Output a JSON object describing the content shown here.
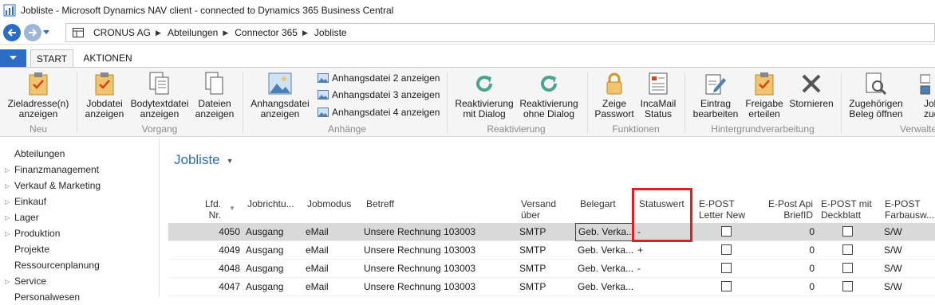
{
  "window": {
    "title": "Jobliste - Microsoft Dynamics NAV client - connected to Dynamics 365 Business Central"
  },
  "nav": {
    "breadcrumbs": [
      "CRONUS AG",
      "Abteilungen",
      "Connector 365",
      "Jobliste"
    ]
  },
  "tabs": {
    "start": "START",
    "aktionen": "AKTIONEN"
  },
  "ribbon": {
    "neu": {
      "label": "Neu",
      "zieladresse": [
        "Zieladresse(n)",
        "anzeigen"
      ]
    },
    "vorgang": {
      "label": "Vorgang",
      "jobdatei": [
        "Jobdatei",
        "anzeigen"
      ],
      "bodytext": [
        "Bodytextdatei",
        "anzeigen"
      ],
      "dateien": [
        "Dateien",
        "anzeigen"
      ]
    },
    "anhaenge": {
      "label": "Anhänge",
      "anhang1": [
        "Anhangsdatei",
        "anzeigen"
      ],
      "anhang2": "Anhangsdatei 2 anzeigen",
      "anhang3": "Anhangsdatei 3 anzeigen",
      "anhang4": "Anhangsdatei 4 anzeigen"
    },
    "reaktivierung": {
      "label": "Reaktivierung",
      "mitdialog": [
        "Reaktivierung",
        "mit Dialog"
      ],
      "ohnedialog": [
        "Reaktivierung",
        "ohne Dialog"
      ]
    },
    "funktionen": {
      "label": "Funktionen",
      "passwort": [
        "Zeige",
        "Passwort"
      ],
      "incamail": [
        "IncaMail",
        "Status"
      ]
    },
    "hintergrund": {
      "label": "Hintergrundverarbeitung",
      "eintrag": [
        "Eintrag",
        "bearbeiten"
      ],
      "freigabe": [
        "Freigabe",
        "erteilen"
      ],
      "stornieren": "Stornieren"
    },
    "verwalten": {
      "label": "Verwalte",
      "zugehoerig": [
        "Zugehörigen",
        "Beleg öffnen"
      ],
      "job": [
        "Job",
        "zuord"
      ]
    }
  },
  "sidebar": {
    "items": [
      {
        "label": "Abteilungen",
        "arrow": ""
      },
      {
        "label": "Finanzmanagement",
        "arrow": "▷"
      },
      {
        "label": "Verkauf & Marketing",
        "arrow": "▷"
      },
      {
        "label": "Einkauf",
        "arrow": "▷"
      },
      {
        "label": "Lager",
        "arrow": "▷"
      },
      {
        "label": "Produktion",
        "arrow": "▷"
      },
      {
        "label": "Projekte",
        "arrow": ""
      },
      {
        "label": "Ressourcenplanung",
        "arrow": ""
      },
      {
        "label": "Service",
        "arrow": "▷"
      },
      {
        "label": "Personalwesen",
        "arrow": ""
      }
    ]
  },
  "page": {
    "title": "Jobliste"
  },
  "table": {
    "headers": {
      "lfd": [
        "Lfd.",
        "Nr."
      ],
      "jobrichtung": "Jobrichtu...",
      "jobmodus": "Jobmodus",
      "betreff": "Betreff",
      "versand": [
        "Versand",
        "über"
      ],
      "belegart": "Belegart",
      "statuswert": "Statuswert",
      "epost_letter": [
        "E-POST",
        "Letter New"
      ],
      "epost_api": [
        "E-Post Api",
        "BriefID"
      ],
      "epost_deckblatt": [
        "E-POST mit",
        "Deckblatt"
      ],
      "epost_farb": [
        "E-POST",
        "Farbausw..."
      ]
    },
    "rows": [
      {
        "nr": "4050",
        "richtung": "Ausgang",
        "modus": "eMail",
        "betreff": "Unsere Rechnung 103003",
        "versand": "SMTP",
        "belegart": "Geb. Verka...",
        "status": "-",
        "letter_new": false,
        "briefid": "0",
        "deckblatt": false,
        "farb": "S/W"
      },
      {
        "nr": "4049",
        "richtung": "Ausgang",
        "modus": "eMail",
        "betreff": "Unsere Rechnung 103003",
        "versand": "SMTP",
        "belegart": "Geb. Verka...",
        "status": "+",
        "letter_new": false,
        "briefid": "0",
        "deckblatt": false,
        "farb": "S/W"
      },
      {
        "nr": "4048",
        "richtung": "Ausgang",
        "modus": "eMail",
        "betreff": "Unsere Rechnung 103003",
        "versand": "SMTP",
        "belegart": "Geb. Verka...",
        "status": "-",
        "letter_new": false,
        "briefid": "0",
        "deckblatt": false,
        "farb": "S/W"
      },
      {
        "nr": "4047",
        "richtung": "Ausgang",
        "modus": "eMail",
        "betreff": "Unsere Rechnung 103003",
        "versand": "SMTP",
        "belegart": "Geb. Verka...",
        "status": "",
        "letter_new": false,
        "briefid": "0",
        "deckblatt": false,
        "farb": "S/W"
      }
    ]
  },
  "colors": {
    "accent": "#2b6cc4",
    "highlight": "#e0201f",
    "selected_row": "#d9d9d9"
  }
}
